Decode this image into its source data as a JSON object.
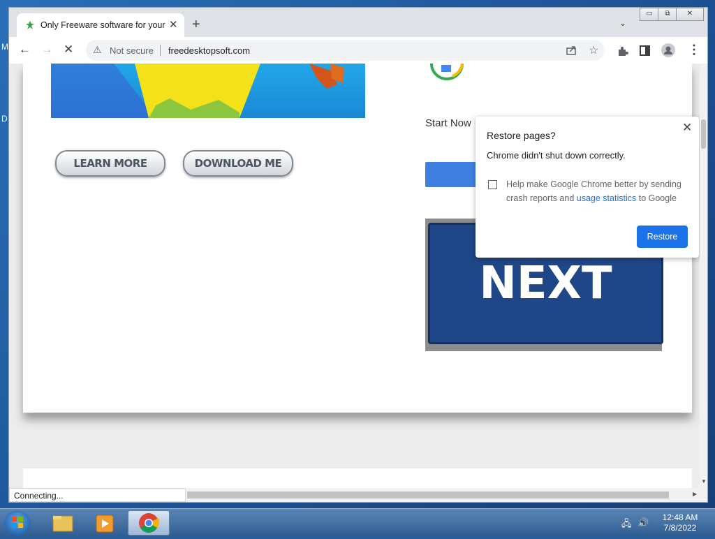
{
  "tab": {
    "title": "Only Freeware software for your",
    "close": "✕"
  },
  "window_controls": {
    "minimize": "▭",
    "maximize": "⧉",
    "close": "✕"
  },
  "toolbar": {
    "back_icon": "←",
    "forward_icon": "→",
    "reload_icon": "✕",
    "security_label": "Not secure",
    "url": "freedesktopsoft.com"
  },
  "page": {
    "learn_more": "LEARN MORE",
    "download_me": "DOWNLOAD ME",
    "start_now": "Start Now",
    "next": "NEXT"
  },
  "restore_popup": {
    "title": "Restore pages?",
    "message": "Chrome didn't shut down correctly.",
    "checkbox_text_1": "Help make Google Chrome better by sending crash reports and",
    "checkbox_link": "usage statistics",
    "checkbox_text_2": "to Google",
    "restore_button": "Restore"
  },
  "status": {
    "text": "Connecting..."
  },
  "taskbar": {
    "time": "12:48 AM",
    "date": "7/8/2022"
  },
  "desktop": {
    "letter_m": "M",
    "letter_d": "D"
  },
  "colors": {
    "accent": "#1a73e8",
    "next_button": "#1f4687",
    "taskbar": "#2f5c90"
  }
}
